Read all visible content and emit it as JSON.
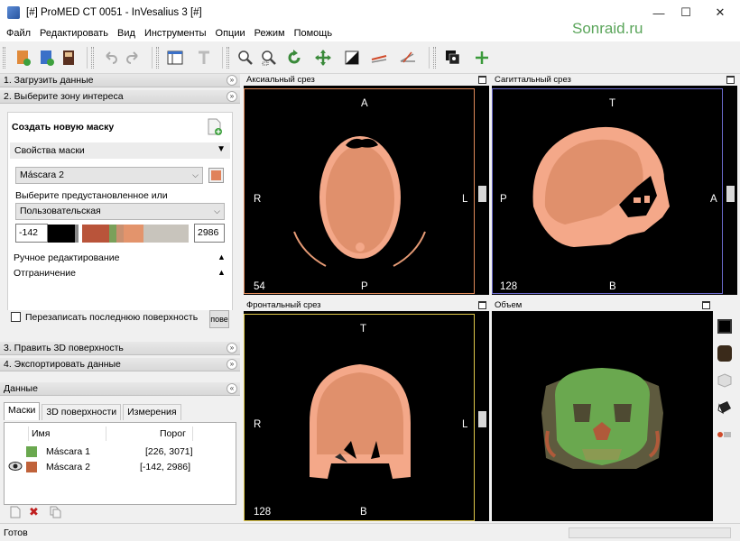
{
  "window": {
    "title": "[#] ProMED CT 0051 - InVesalius 3 [#]",
    "min_glyph": "—",
    "max_glyph": "☐",
    "close_glyph": "✕"
  },
  "watermark": "Sonraid.ru",
  "menu": [
    "Файл",
    "Редактировать",
    "Вид",
    "Инструменты",
    "Опции",
    "Режим",
    "Помощь"
  ],
  "left_panel": {
    "sections": [
      {
        "label": "1. Загрузить данные"
      },
      {
        "label": "2. Выберите зону интереса"
      },
      {
        "label": "3. Править 3D поверхность"
      },
      {
        "label": "4. Экспортировать данные"
      },
      {
        "label": "Данные"
      }
    ],
    "create_mask_label": "Создать новую маску",
    "mask_props_label": "Свойства маски",
    "mask_select_value": "Máscara 2",
    "mask_color": "#e0825a",
    "preset_label": "Выберите предустановленное или",
    "preset_value": "Пользовательская",
    "threshold_min": "-142",
    "threshold_max": "2986",
    "manual_edit_label": "Ручное редактирование",
    "limit_label": "Отграничение",
    "overwrite_label": "Перезаписать последнюю поверхность",
    "overwrite_btn": "пове"
  },
  "data_tabs": [
    "Маски",
    "3D поверхности",
    "Измерения"
  ],
  "mask_table": {
    "col_name": "Имя",
    "col_threshold": "Порог",
    "rows": [
      {
        "name": "Máscara 1",
        "threshold": "[226, 3071]",
        "color": "#6aa84f"
      },
      {
        "name": "Máscara 2",
        "threshold": "[-142, 2986]",
        "color": "#c0623a"
      }
    ]
  },
  "views": {
    "axial": {
      "title": "Аксиальный срез",
      "top": "A",
      "bottom": "P",
      "left": "R",
      "right": "L",
      "slice": "54"
    },
    "sagittal": {
      "title": "Сагиттальный срез",
      "top": "T",
      "bottom": "B",
      "left": "P",
      "right": "A",
      "slice": "128"
    },
    "coronal": {
      "title": "Фронтальный срез",
      "top": "T",
      "bottom": "B",
      "left": "R",
      "right": "L",
      "slice": "128"
    },
    "volume": {
      "title": "Объем"
    }
  },
  "status": "Готов",
  "glyphs": {
    "down": "▼",
    "up": "▲",
    "fold": "»",
    "eye": "👁"
  }
}
